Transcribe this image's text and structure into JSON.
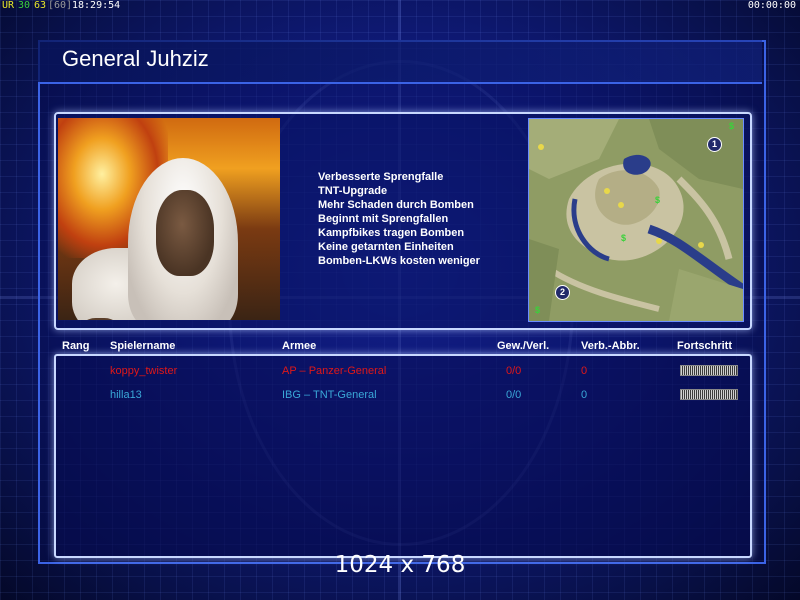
{
  "hud": {
    "fps_label": "UR",
    "fps_a": "30",
    "fps_b": "63",
    "fps_c": "[60]",
    "clock": "18:29:54",
    "timer": "00:00:00"
  },
  "general": {
    "title": "General Juhziz",
    "traits": [
      "Verbesserte Sprengfalle",
      "TNT-Upgrade",
      "Mehr Schaden durch Bomben",
      "Beginnt mit Sprengfallen",
      "Kampfbikes tragen Bomben",
      "Keine getarnten Einheiten",
      "Bomben-LKWs kosten weniger"
    ]
  },
  "minimap": {
    "markers": [
      "1",
      "2"
    ]
  },
  "table": {
    "headers": {
      "rank": "Rang",
      "player": "Spielername",
      "army": "Armee",
      "win_loss": "Gew./Verl.",
      "disconnects": "Verb.-Abbr.",
      "progress": "Fortschritt"
    },
    "rows": [
      {
        "player": "koppy_twister",
        "army": "AP – Panzer-General",
        "win_loss": "0/0",
        "disconnects": "0",
        "color": "#e01818"
      },
      {
        "player": "hilla13",
        "army": "IBG – TNT-General",
        "win_loss": "0/0",
        "disconnects": "0",
        "color": "#3aa8d8"
      }
    ]
  },
  "resolution": "1024 x 768"
}
